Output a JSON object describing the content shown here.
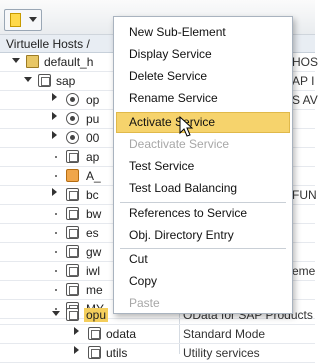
{
  "header": {
    "title": "Virtuelle Hosts /"
  },
  "tree": {
    "rows": [
      {
        "name": "default_h",
        "right": "HOS",
        "expander": "down"
      },
      {
        "name": "sap",
        "right": "AP I",
        "expander": "down"
      },
      {
        "name": "op",
        "right": "S AV",
        "icon": "circle"
      },
      {
        "name": "pu",
        "right": "",
        "icon": "circle"
      },
      {
        "name": "00",
        "right": "",
        "icon": "circle"
      },
      {
        "name": "ap",
        "right": "",
        "icon": "box"
      },
      {
        "name": "A_",
        "right": "",
        "icon": "warning"
      },
      {
        "name": "bc",
        "right": "FUN",
        "icon": "box"
      },
      {
        "name": "bw",
        "right": "",
        "icon": "box"
      },
      {
        "name": "es",
        "right": "",
        "icon": "box"
      },
      {
        "name": "gw",
        "right": "",
        "icon": "box"
      },
      {
        "name": "iwl",
        "right": "eme",
        "icon": "box"
      },
      {
        "name": "me",
        "right": "",
        "icon": "box"
      },
      {
        "name": "MY",
        "right": "",
        "icon": "box"
      },
      {
        "name": "opu",
        "right": "",
        "icon": "box",
        "selected": true
      },
      {
        "name": "odata",
        "desc": "Standard Mode",
        "icon": "box"
      },
      {
        "name": "utils",
        "desc": "Utility services",
        "icon": "box"
      }
    ],
    "selected_desc": "OData for SAP Products"
  },
  "context_menu": {
    "items": [
      {
        "label": "New Sub-Element",
        "enabled": true
      },
      {
        "label": "Display Service",
        "enabled": true
      },
      {
        "label": "Delete Service",
        "enabled": true
      },
      {
        "label": "Rename Service",
        "enabled": true
      },
      {
        "label": "Activate Service",
        "enabled": true,
        "highlighted": true
      },
      {
        "label": "Deactivate Service",
        "enabled": false
      },
      {
        "label": "Test Service",
        "enabled": true
      },
      {
        "label": "Test Load Balancing",
        "enabled": true
      },
      {
        "label": "References to Service",
        "enabled": true
      },
      {
        "label": "Obj. Directory Entry",
        "enabled": true
      },
      {
        "label": "Cut",
        "enabled": true
      },
      {
        "label": "Copy",
        "enabled": true
      },
      {
        "label": "Paste",
        "enabled": false
      }
    ]
  },
  "icons": {
    "toolbar": "document-dropdown-icon",
    "cursor": "mouse-pointer-icon"
  },
  "colors": {
    "highlight": "#f6d36c",
    "selection": "#f4ce5c",
    "disabled_text": "#a7a7a7"
  }
}
